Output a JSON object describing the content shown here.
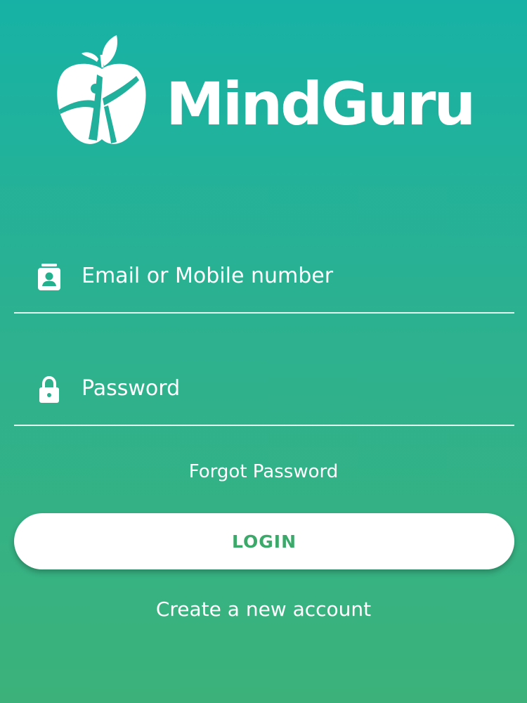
{
  "app": {
    "brand_name": "MindGuru",
    "logo_icon": "apple-leaf-figure-icon"
  },
  "login_form": {
    "email": {
      "placeholder": "Email or Mobile number",
      "value": "",
      "icon": "contact-card-icon"
    },
    "password": {
      "placeholder": "Password",
      "value": "",
      "icon": "lock-icon"
    },
    "forgot_label": "Forgot Password",
    "login_label": "LOGIN",
    "create_account_label": "Create a new account"
  },
  "colors": {
    "background_top": "#17b2a5",
    "background_bottom": "#3cb27a",
    "button_background": "#ffffff",
    "button_text": "#3aa96a",
    "text": "#ffffff"
  }
}
